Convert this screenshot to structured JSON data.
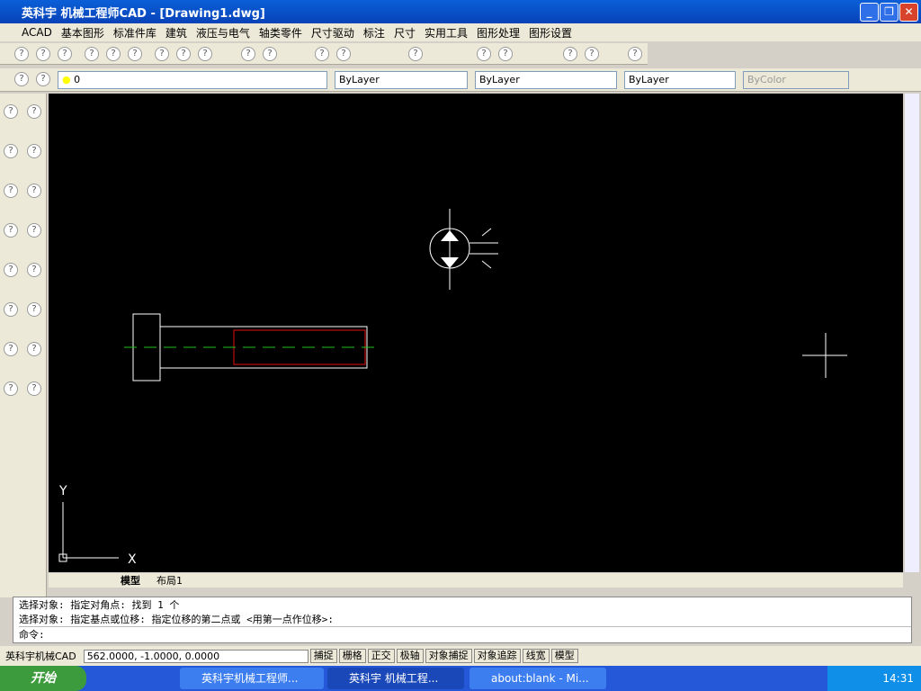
{
  "window": {
    "title": "英科宇 机械工程师CAD - [Drawing1.dwg]"
  },
  "menu": [
    "ACAD",
    "基本图形",
    "标准件库",
    "建筑",
    "液压与电气",
    "轴类零件",
    "尺寸驱动",
    "标注",
    "尺寸",
    "实用工具",
    "图形处理",
    "图形设置"
  ],
  "layer": {
    "current": "0"
  },
  "properties": {
    "color": "ByLayer",
    "linetype": "ByLayer",
    "lineweight": "ByLayer",
    "plotstyle": "ByColor"
  },
  "canvas": {
    "axis_y": "Y",
    "axis_x": "X"
  },
  "tabs": {
    "model": "模型",
    "layout": "布局1"
  },
  "command": {
    "line1": "选择对象: 指定对角点: 找到 1 个",
    "line2": "选择对象:  指定基点或位移: 指定位移的第二点或 <用第一点作位移>:",
    "prompt": "命令:"
  },
  "status": {
    "app": "英科宇机械CAD",
    "coords": "562.0000, -1.0000, 0.0000",
    "buttons": [
      "捕捉",
      "栅格",
      "正交",
      "极轴",
      "对象捕捉",
      "对象追踪",
      "线宽",
      "模型"
    ]
  },
  "taskbar": {
    "start": "开始",
    "tasks": [
      "英科宇机械工程师...",
      "英科宇 机械工程...",
      "about:blank - Mi..."
    ],
    "clock": "14:31"
  }
}
